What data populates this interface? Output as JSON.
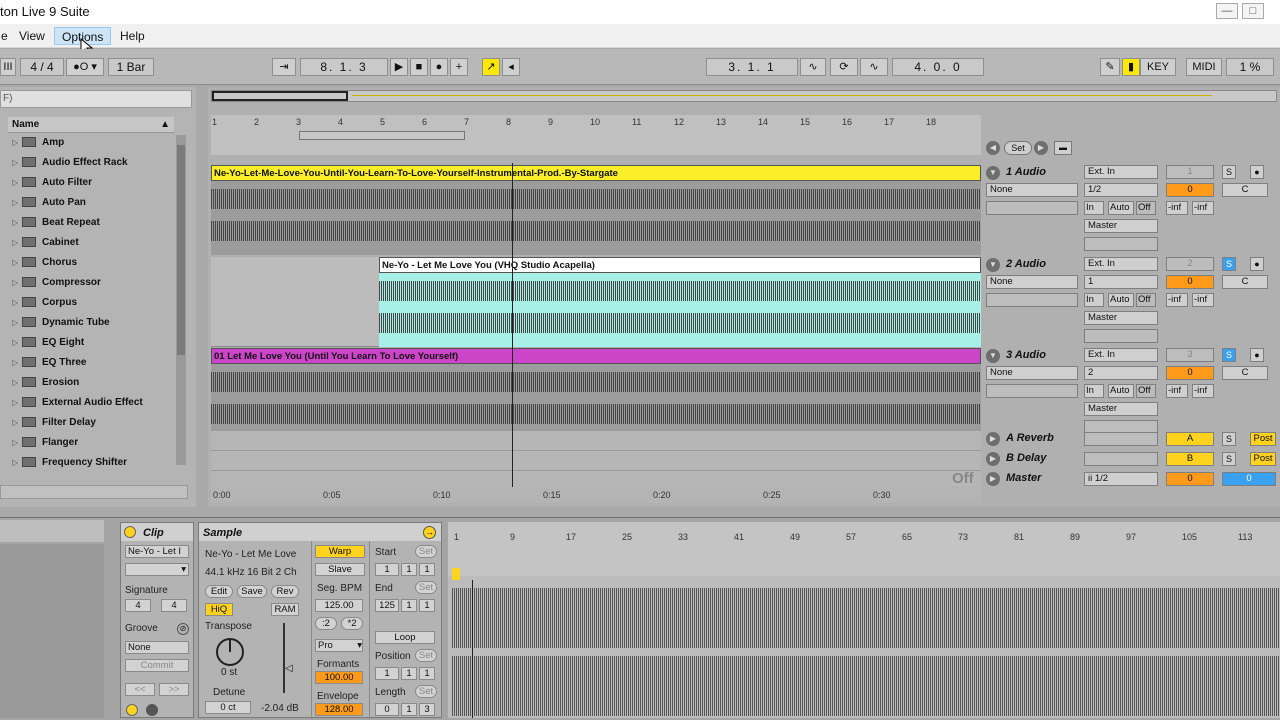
{
  "window": {
    "title": "ton Live 9 Suite",
    "controls": [
      "—",
      "□",
      "✕"
    ]
  },
  "menu": [
    {
      "label": "e"
    },
    {
      "label": "View"
    },
    {
      "label": "Options"
    },
    {
      "label": "Help"
    }
  ],
  "transport": {
    "signature": "4 / 4",
    "quantize": "1 Bar",
    "position": "8.   1.   3",
    "loop_start": "3.   1.   1",
    "loop_length": "4.   0.   0",
    "key_label": "KEY",
    "midi_label": "MIDI",
    "cpu": "1 %"
  },
  "browser": {
    "search_placeholder": "F)",
    "header": "Name",
    "items": [
      "Amp",
      "Audio Effect Rack",
      "Auto Filter",
      "Auto Pan",
      "Beat Repeat",
      "Cabinet",
      "Chorus",
      "Compressor",
      "Corpus",
      "Dynamic Tube",
      "EQ Eight",
      "EQ Three",
      "Erosion",
      "External Audio Effect",
      "Filter Delay",
      "Flanger",
      "Frequency Shifter"
    ]
  },
  "ruler": {
    "bars": [
      "1",
      "2",
      "3",
      "4",
      "5",
      "6",
      "7",
      "8",
      "9",
      "10",
      "11",
      "12",
      "13",
      "14",
      "15",
      "16",
      "17",
      "18"
    ],
    "times": [
      "0:00",
      "0:05",
      "0:10",
      "0:15",
      "0:20",
      "0:25",
      "0:30"
    ],
    "set_label": "Set",
    "off_label": "Off"
  },
  "tracks": [
    {
      "name": "1 Audio",
      "clip": "Ne-Yo-Let-Me-Love-You-Until-You-Learn-To-Love-Yourself-Instrumental-Prod.-By-Stargate",
      "clip_color": "#f9ee27",
      "wave_color": "#9c9c9c",
      "input_type": "Ext. In",
      "input_ch": "1/2",
      "monitor": [
        "In",
        "Auto",
        "Off"
      ],
      "output": "Master",
      "sends": "None",
      "vol": "0",
      "pan": "C",
      "num": "1",
      "inf": [
        "-inf",
        "-inf"
      ]
    },
    {
      "name": "2 Audio",
      "clip": "Ne-Yo - Let Me Love You (VHQ Studio Acapella)",
      "clip_color": "#ffffff",
      "wave_color": "#a8efe7",
      "input_type": "Ext. In",
      "input_ch": "1",
      "monitor": [
        "In",
        "Auto",
        "Off"
      ],
      "output": "Master",
      "sends": "None",
      "vol": "0",
      "pan": "C",
      "num": "2",
      "inf": [
        "-inf",
        "-inf"
      ]
    },
    {
      "name": "3 Audio",
      "clip": "01 Let Me Love You (Until You Learn To Love Yourself)",
      "clip_color": "#cc44c8",
      "wave_color": "#9c9c9c",
      "input_type": "Ext. In",
      "input_ch": "2",
      "monitor": [
        "In",
        "Auto",
        "Off"
      ],
      "output": "Master",
      "sends": "None",
      "vol": "0",
      "pan": "C",
      "num": "3",
      "inf": [
        "-inf",
        "-inf"
      ]
    }
  ],
  "returns": [
    {
      "name": "A Reverb",
      "letter": "A",
      "post": "Post"
    },
    {
      "name": "B Delay",
      "letter": "B",
      "post": "Post"
    },
    {
      "name": "Master",
      "letter": "0",
      "post": "0",
      "out": "ii 1/2"
    }
  ],
  "clip_panel": {
    "clip_label": "Clip",
    "clip_name": "Ne-Yo - Let I",
    "signature_label": "Signature",
    "sig_num": "4",
    "sig_den": "4",
    "groove_label": "Groove",
    "groove_value": "None",
    "commit_label": "Commit",
    "sample_label": "Sample",
    "sample_name": "Ne-Yo - Let Me Love",
    "sample_info": "44.1 kHz 16 Bit 2 Ch",
    "edit": "Edit",
    "save": "Save",
    "rev": "Rev",
    "hiq": "HiQ",
    "ram": "RAM",
    "transpose_label": "Transpose",
    "transpose_value": "0 st",
    "detune_label": "Detune",
    "detune_value": "0 ct",
    "gain": "-2.04 dB",
    "warp": "Warp",
    "slave": "Slave",
    "seg_bpm_label": "Seg. BPM",
    "seg_bpm": "125.00",
    "x2": ":2",
    "times2": "*2",
    "warp_mode": "Pro",
    "formants_label": "Formants",
    "formants": "100.00",
    "envelope_label": "Envelope",
    "envelope": "128.00",
    "start_label": "Start",
    "end_label": "End",
    "set": "Set",
    "start_vals": [
      "1",
      "1",
      "1"
    ],
    "end_vals": [
      "125",
      "1",
      "1"
    ],
    "loop_label": "Loop",
    "position_label": "Position",
    "length_label": "Length",
    "pos_vals": [
      "1",
      "1",
      "1"
    ],
    "len_vals": [
      "0",
      "1",
      "3"
    ],
    "ruler": [
      "1",
      "9",
      "17",
      "25",
      "33",
      "41",
      "49",
      "57",
      "65",
      "73",
      "81",
      "89",
      "97",
      "105",
      "113"
    ]
  }
}
